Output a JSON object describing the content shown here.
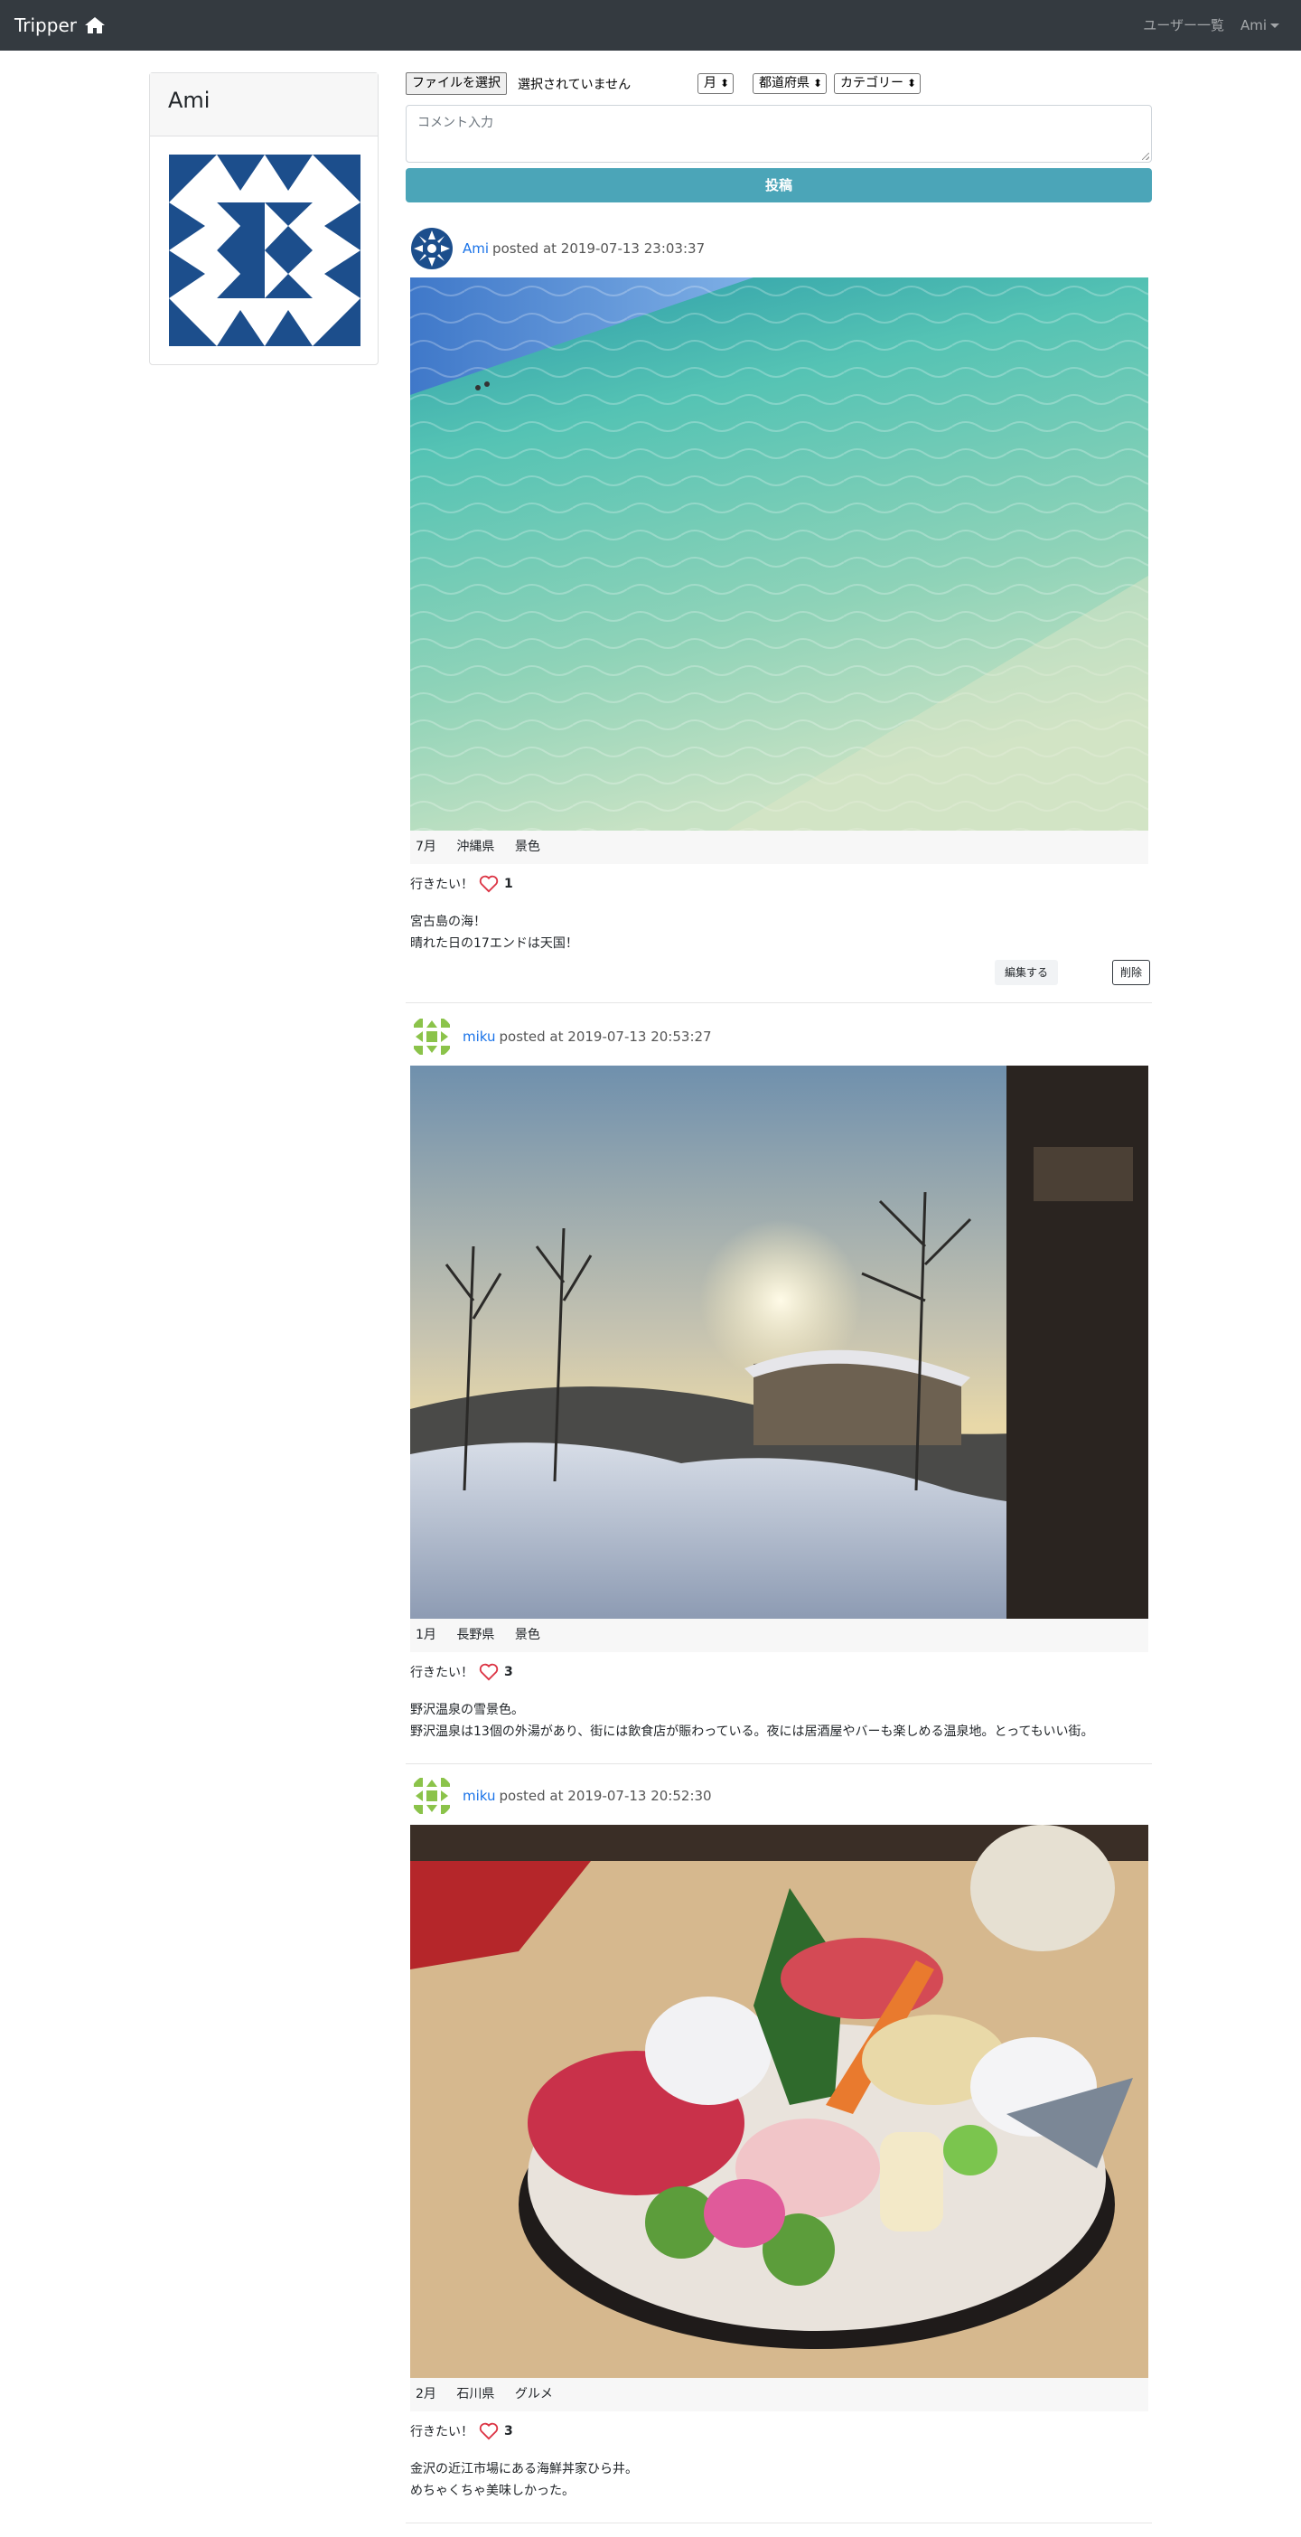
{
  "navbar": {
    "brand": "Tripper",
    "users_link": "ユーザー一覧",
    "user_menu": "Ami"
  },
  "profile": {
    "name": "Ami"
  },
  "form": {
    "file_button": "ファイルを選択",
    "file_status": "選択されていません",
    "month_select": "月",
    "prefecture_select": "都道府県",
    "category_select": "カテゴリー",
    "comment_placeholder": "コメント入力",
    "submit_label": "投稿"
  },
  "posts": [
    {
      "user": "Ami",
      "posted_at": "posted at 2019-07-13 23:03:37",
      "month": "7月",
      "prefecture": "沖縄県",
      "category": "景色",
      "like_label": "行きたい！",
      "like_count": "1",
      "text_line1": "宮古島の海！",
      "text_line2": "晴れた日の17エンドは天国！",
      "edit_label": "編集する",
      "delete_label": "削除"
    },
    {
      "user": "miku",
      "posted_at": "posted at 2019-07-13 20:53:27",
      "month": "1月",
      "prefecture": "長野県",
      "category": "景色",
      "like_label": "行きたい！",
      "like_count": "3",
      "text_line1": "野沢温泉の雪景色。",
      "text_line2": "野沢温泉は13個の外湯があり、街には飲食店が賑わっている。夜には居酒屋やバーも楽しめる温泉地。とってもいい街。"
    },
    {
      "user": "miku",
      "posted_at": "posted at 2019-07-13 20:52:30",
      "month": "2月",
      "prefecture": "石川県",
      "category": "グルメ",
      "like_label": "行きたい！",
      "like_count": "3",
      "text_line1": "金沢の近江市場にある海鮮丼家ひら井。",
      "text_line2": "めちゃくちゃ美味しかった。"
    }
  ],
  "colors": {
    "navbar_bg": "#343a40",
    "accent": "#4ba5b8",
    "link": "#1a73e8",
    "heart": "#dc3545",
    "ami_avatar": "#1c4e8c",
    "miku_avatar": "#8bc34a"
  }
}
